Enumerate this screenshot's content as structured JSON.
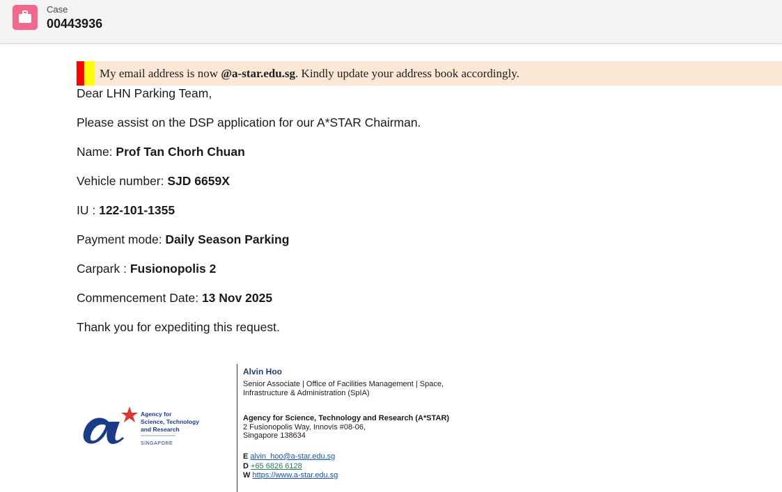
{
  "header": {
    "icon": "briefcase-icon",
    "icon_color": "#f2688c",
    "label": "Case",
    "number": "00443936"
  },
  "banner": {
    "text_before": "My email address is now ",
    "domain": "@a-star.edu.sg",
    "text_after": ". Kindly update your address book accordingly."
  },
  "email": {
    "greeting": "Dear LHN Parking Team,",
    "intro": "Please assist on the DSP application for our A*STAR Chairman.",
    "fields": [
      {
        "label": "Name: ",
        "value": "Prof Tan Chorh Chuan"
      },
      {
        "label": "Vehicle number: ",
        "value": "SJD 6659X"
      },
      {
        "label": "IU : ",
        "value": "122-101-1355"
      },
      {
        "label": "Payment mode: ",
        "value": "Daily Season Parking"
      },
      {
        "label": "Carpark : ",
        "value": "Fusionopolis 2"
      },
      {
        "label": "Commencement Date: ",
        "value": "13 Nov 2025"
      }
    ],
    "closing": "Thank you for expediting this request."
  },
  "logo": {
    "line1": "Agency for",
    "line2": "Science, Technology",
    "line3": "and Research",
    "line4": "SINGAPORE"
  },
  "signature": {
    "name": "Alvin Hoo",
    "title_line1": "Senior Associate | Office of Facilities Management | Space,",
    "title_line2": "Infrastructure & Administration (SpIA)",
    "org": "Agency for Science, Technology and Research (A*STAR)",
    "address_line1": "2 Fusionopolis Way, Innovis #08-06,",
    "address_line2": "Singapore 138634",
    "email_label": "E",
    "email": "alvin_hoo@a-star.edu.sg",
    "phone_label": "D",
    "phone": "+65 6826 6128",
    "web_label": "W",
    "web": "https://www.a-star.edu.sg"
  }
}
